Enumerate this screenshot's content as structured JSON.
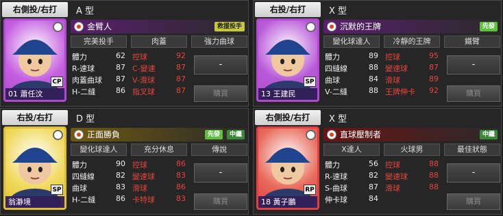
{
  "cards": [
    {
      "hand": "右側投/右打",
      "type": "A 型",
      "player": "01 蕭任汶",
      "position": "CP",
      "name": "金臂人",
      "badges": [
        "救援投手"
      ],
      "skills": [
        "完美投手",
        "肉蓋",
        "強力曲球"
      ],
      "stats": [
        [
          "體力",
          "62",
          "控球",
          "92"
        ],
        [
          "R-速球",
          "87",
          "C-變速",
          "87"
        ],
        [
          "肉蓋曲球",
          "87",
          "V-滑球",
          "87"
        ],
        [
          "H-二縫",
          "86",
          "指叉球",
          "87"
        ]
      ],
      "dash": "-",
      "buy": "購買",
      "colors": {
        "bar": "#5a1f6e",
        "frame": "#b04ad0",
        "bg": "#c55fe0"
      }
    },
    {
      "hand": "右投/右打",
      "type": "X 型",
      "player": "13 王建民",
      "position": "SP",
      "name": "沉默的王牌",
      "badges": [
        "先發"
      ],
      "skills": [
        "變化球達人",
        "冷靜的王牌",
        "鐵臂"
      ],
      "stats": [
        [
          "體力",
          "89",
          "控球",
          "95"
        ],
        [
          "四縫線",
          "88",
          "變速球",
          "87"
        ],
        [
          "曲球",
          "84",
          "滑球",
          "89"
        ],
        [
          "V-二縫",
          "88",
          "王牌伸卡",
          "92"
        ]
      ],
      "dash": "-",
      "buy": "購買",
      "colors": {
        "bar": "#5a1f6e",
        "frame": "#b04ad0",
        "bg": "#b85ad8"
      }
    },
    {
      "hand": "右投/右打",
      "type": "D 型",
      "player": "翁瀞境",
      "position": "SP",
      "name": "正面勝負",
      "badges": [
        "先發",
        "中繼"
      ],
      "skills": [
        "變化球達人",
        "充分休息",
        "傳說"
      ],
      "stats": [
        [
          "體力",
          "90",
          "控球",
          "86"
        ],
        [
          "四縫線",
          "82",
          "變速球",
          "83"
        ],
        [
          "曲球",
          "83",
          "滑球",
          "86"
        ],
        [
          "H-二縫",
          "86",
          "卡特球",
          "83"
        ]
      ],
      "dash": "-",
      "buy": "購買",
      "colors": {
        "bar": "#6e5a10",
        "frame": "#e0c030",
        "bg": "#f0d85a"
      }
    },
    {
      "hand": "右側投/右打",
      "type": "X 型",
      "player": "18 黃子鵬",
      "position": "RP",
      "name": "直球壓制者",
      "badges": [
        "中繼"
      ],
      "skills": [
        "X達人",
        "火球男",
        "最佳狀態"
      ],
      "stats": [
        [
          "體力",
          "56",
          "控球",
          "88"
        ],
        [
          "R-速球",
          "82",
          "變速球",
          "88"
        ],
        [
          "S-曲球",
          "87",
          "滑球",
          "88"
        ],
        [
          "伸卡球",
          "84",
          "",
          ""
        ]
      ],
      "dash": "-",
      "buy": "購買",
      "colors": {
        "bar": "#6a1414",
        "frame": "#e04040",
        "bg": "#e86a5a"
      }
    }
  ]
}
